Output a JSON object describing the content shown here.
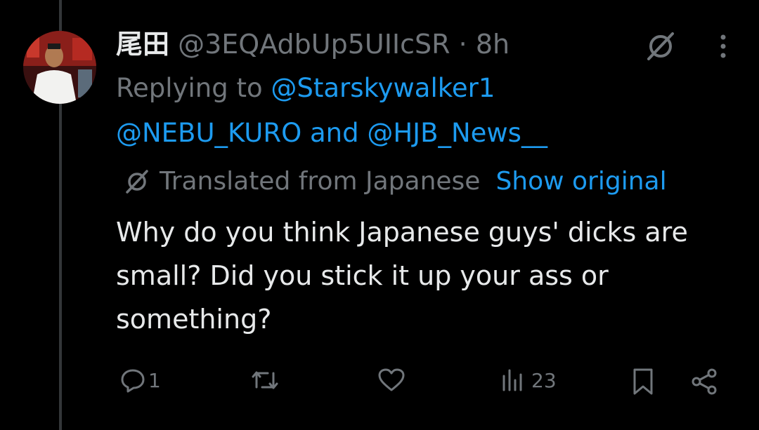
{
  "tweet": {
    "display_name": "尾田",
    "handle": "@3EQAdbUp5UIIcSR",
    "separator": "·",
    "time": "8h",
    "replying_prefix": "Replying to",
    "reply_to_1": "@Starskywalker1",
    "reply_to_2": "@NEBU_KURO",
    "reply_join": "and",
    "reply_to_3": "@HJB_News__",
    "translated_label": "Translated from Japanese",
    "show_original": "Show original",
    "text": "Why do you think Japanese guys' dicks are small? Did you stick it up your ass or something?"
  },
  "actions": {
    "reply_count": "1",
    "retweet_count": "",
    "like_count": "",
    "views_count": "23"
  },
  "icons": {
    "header_translate": "grok-slash-icon",
    "more": "more-vertical-icon",
    "translate": "translate-slash-icon",
    "reply": "reply-bubble-icon",
    "retweet": "retweet-icon",
    "like": "heart-icon",
    "views": "views-bars-icon",
    "bookmark": "bookmark-icon",
    "share": "share-icon"
  },
  "colors": {
    "background": "#000000",
    "text": "#e7e9ea",
    "muted": "#71767b",
    "link": "#1d9bf0"
  }
}
